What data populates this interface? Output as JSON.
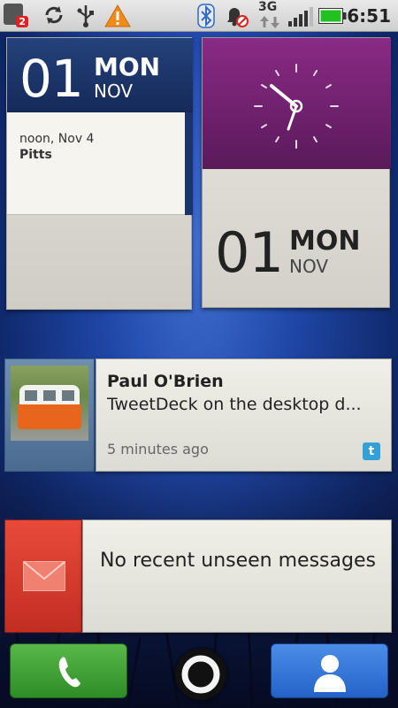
{
  "status_bar": {
    "notification_badge": "2",
    "network": "3G",
    "time": "6:51"
  },
  "calendar_widget": {
    "day": "01",
    "weekday": "MON",
    "month": "NOV",
    "event_time": "noon, Nov 4",
    "event_location": "Pitts"
  },
  "clock_widget": {
    "day": "01",
    "weekday": "MON",
    "month": "NOV"
  },
  "social_widget": {
    "name": "Paul O'Brien",
    "message": "TweetDeck on the desktop d...",
    "time_ago": "5 minutes ago",
    "service_icon": "twitter-icon"
  },
  "messages_widget": {
    "text": "No recent unseen messages",
    "icon": "envelope-icon"
  },
  "dock": {
    "phone_icon": "phone-icon",
    "home_icon": "home-icon",
    "contacts_icon": "contacts-icon"
  },
  "colors": {
    "calendar_header": "#1d3568",
    "clock_face": "#7a2475",
    "messages_accent": "#d83a2c",
    "phone_green": "#3ea636",
    "contacts_blue": "#3a7ee0",
    "battery_green": "#22c020"
  }
}
